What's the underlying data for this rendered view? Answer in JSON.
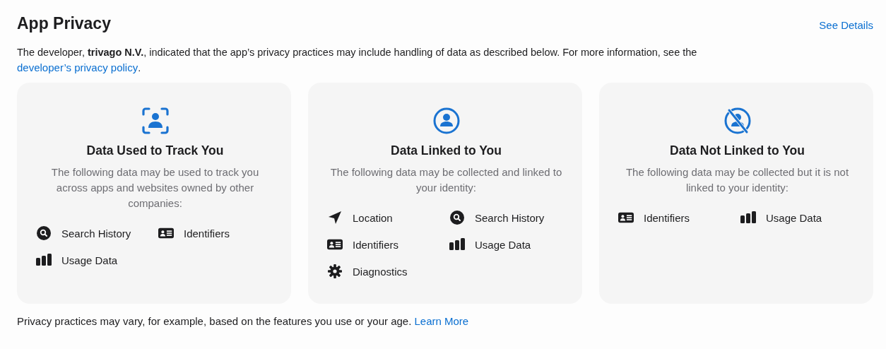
{
  "title": "App Privacy",
  "see_details": "See Details",
  "intro": {
    "text": "The developer, **trivago N.V.**, indicated that the app’s privacy practices may include handling of data as described below. For more information, see the",
    "link": "developer’s privacy policy",
    "after": "."
  },
  "cards": [
    {
      "kind": "track",
      "title": "Data Used to Track You",
      "description": "The following data may be used to track you across apps and websites owned by other companies:",
      "items": [
        {
          "kind": "search",
          "label": "Search History"
        },
        {
          "kind": "id",
          "label": "Identifiers"
        },
        {
          "kind": "usage",
          "label": "Usage Data"
        }
      ]
    },
    {
      "kind": "linked",
      "title": "Data Linked to You",
      "description": "The following data may be collected and linked to your identity:",
      "items": [
        {
          "kind": "location",
          "label": "Location"
        },
        {
          "kind": "search",
          "label": "Search History"
        },
        {
          "kind": "id",
          "label": "Identifiers"
        },
        {
          "kind": "usage",
          "label": "Usage Data"
        },
        {
          "kind": "diagnostics",
          "label": "Diagnostics"
        }
      ]
    },
    {
      "kind": "not-linked",
      "title": "Data Not Linked to You",
      "description": "The following data may be collected but it is not linked to your identity:",
      "items": [
        {
          "kind": "id",
          "label": "Identifiers"
        },
        {
          "kind": "usage",
          "label": "Usage Data"
        }
      ]
    }
  ],
  "footer": {
    "text": "Privacy practices may vary, for example, based on the features you use or your age.",
    "link": "Learn More"
  }
}
